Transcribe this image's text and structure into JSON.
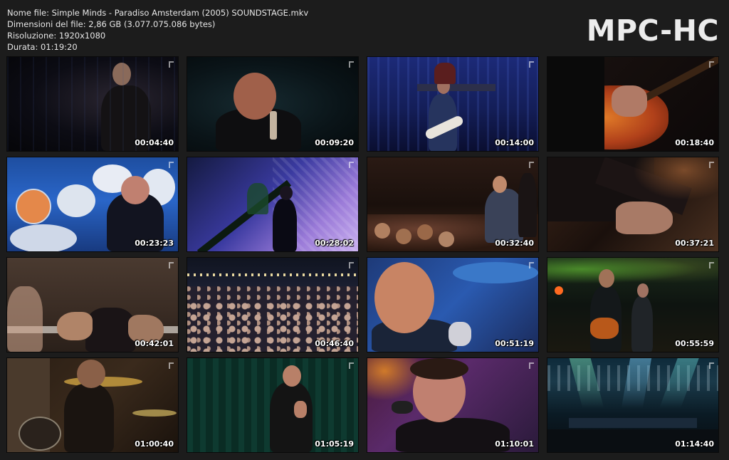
{
  "header": {
    "file_name": "Nome file: Simple Minds - Paradiso Amsterdam (2005) SOUNDSTAGE.mkv",
    "file_size": "Dimensioni del file: 2,86 GB (3.077.075.086 bytes)",
    "resolution": "Risoluzione: 1920x1080",
    "duration": "Durata: 01:19:20"
  },
  "logo": "MPC-HC",
  "thumbnails": [
    {
      "time": "00:04:40"
    },
    {
      "time": "00:09:20"
    },
    {
      "time": "00:14:00"
    },
    {
      "time": "00:18:40"
    },
    {
      "time": "00:23:23"
    },
    {
      "time": "00:28:02"
    },
    {
      "time": "00:32:40"
    },
    {
      "time": "00:37:21"
    },
    {
      "time": "00:42:01"
    },
    {
      "time": "00:46:40"
    },
    {
      "time": "00:51:19"
    },
    {
      "time": "00:55:59"
    },
    {
      "time": "01:00:40"
    },
    {
      "time": "01:05:19"
    },
    {
      "time": "01:10:01"
    },
    {
      "time": "01:14:40"
    }
  ]
}
